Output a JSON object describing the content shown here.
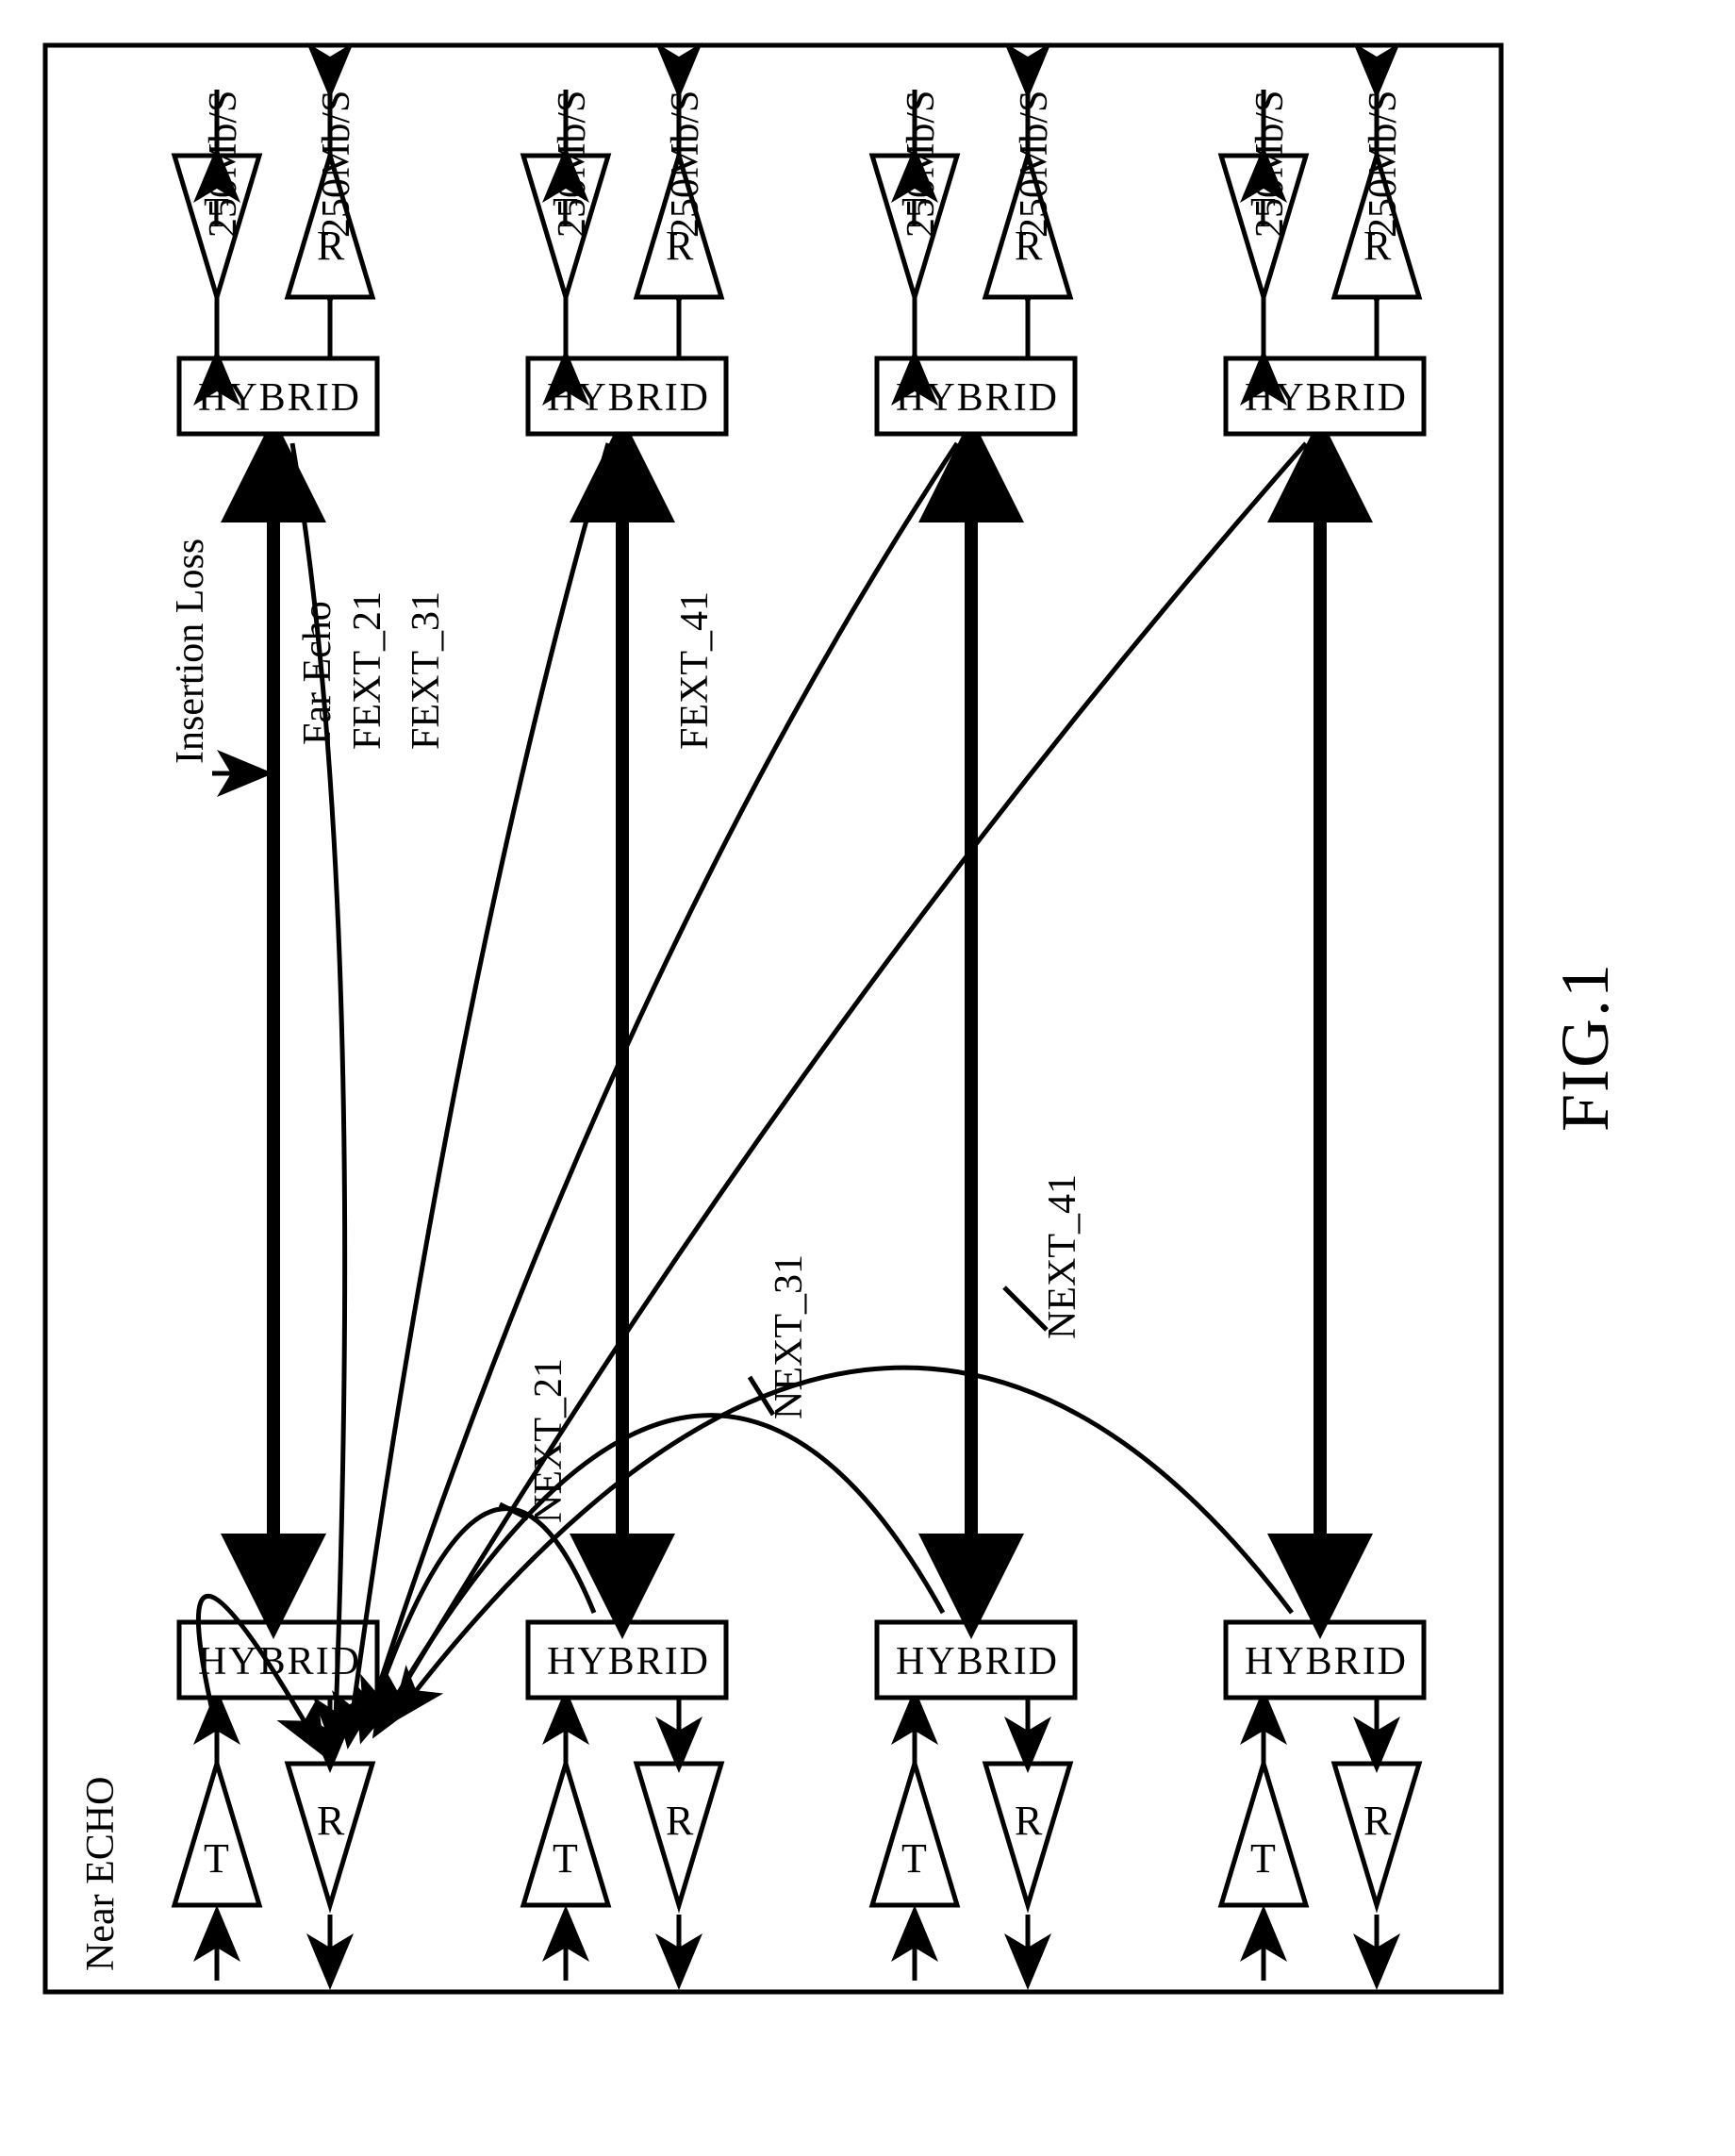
{
  "figure_label": "FIG.1",
  "labels": {
    "near_echo": "Near ECHO",
    "insertion_loss": "Insertion Loss",
    "far_echo": "Far Echo",
    "fext_21": "FEXT_21",
    "fext_31": "FEXT_31",
    "fext_41": "FEXT_41",
    "next_21": "NEXT_21",
    "next_31": "NEXT_31",
    "next_41": "NEXT_41"
  },
  "amp": {
    "T": "T",
    "R": "R"
  },
  "hybrid": "HYBRID",
  "rate": "250Mb/S"
}
